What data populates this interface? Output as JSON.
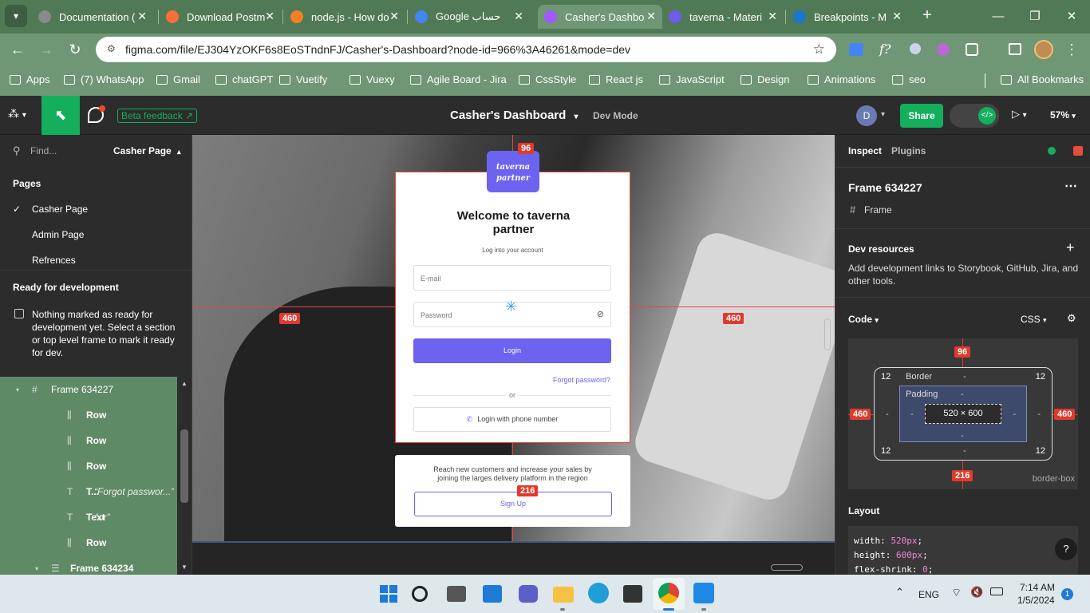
{
  "browser": {
    "tabs": [
      {
        "title": "Documentation (",
        "color": "#8a8a8a"
      },
      {
        "title": "Download Postm",
        "color": "#ff6c37"
      },
      {
        "title": "node.js - How do",
        "color": "#f48024"
      },
      {
        "title": "Google حساب",
        "color": "#4285f4"
      },
      {
        "title": "Casher's Dashbo",
        "color": "#a259ff"
      },
      {
        "title": "taverna - Materi",
        "color": "#6c5ce7"
      },
      {
        "title": "Breakpoints - M",
        "color": "#1976d2"
      }
    ],
    "url": "figma.com/file/EJ304YzOKF6s8EoSTndnFJ/Casher's-Dashboard?node-id=966%3A46261&mode=dev",
    "bookmarks": [
      "Apps",
      "(7) WhatsApp",
      "Gmail",
      "chatGPT",
      "Vuetify",
      "Vuexy",
      "Agile Board - Jira",
      "CssStyle",
      "React js",
      "JavaScript",
      "Design",
      "Animations",
      "seo"
    ],
    "all_bookmarks": "All Bookmarks"
  },
  "figma": {
    "beta_feedback": "Beta feedback",
    "file_title": "Casher's Dashboard",
    "mode": "Dev Mode",
    "avatar": "D",
    "share": "Share",
    "zoom": "57%"
  },
  "left_panel": {
    "find_placeholder": "Find...",
    "current_page": "Casher Page",
    "pages_heading": "Pages",
    "pages": [
      "Casher Page",
      "Admin Page",
      "Refrences"
    ],
    "ready_heading": "Ready for development",
    "ready_text": "Nothing marked as ready for development yet. Select a section or top level frame to mark it ready for dev.",
    "layers": [
      {
        "name": "Frame 634227",
        "type": "frame"
      },
      {
        "name": "Row",
        "type": "row"
      },
      {
        "name": "Row",
        "type": "row"
      },
      {
        "name": "Row",
        "type": "row"
      },
      {
        "name": "T...",
        "type": "text",
        "sub": "“Forgot passwor...”"
      },
      {
        "name": "Text",
        "type": "text",
        "sub": "“or”"
      },
      {
        "name": "Row",
        "type": "row"
      },
      {
        "name": "Frame 634234",
        "type": "frame"
      }
    ]
  },
  "canvas": {
    "logo_line1": "taverna",
    "logo_line2": "partner",
    "welcome_title": "Welcome to taverna partner",
    "subtitle": "Log into your account",
    "email_placeholder": "E-mail",
    "password_placeholder": "Password",
    "login_button": "Login",
    "forgot_password": "Forgot password?",
    "or": "or",
    "phone_login": "Login with phone number",
    "signup_text": "Reach new customers and increase your sales by joining the larges delivery platform in the region",
    "signup_button": "Sign Up",
    "measure_top": "96",
    "measure_left": "460",
    "measure_right": "460",
    "measure_bottom": "216"
  },
  "right_panel": {
    "tabs": [
      "Inspect",
      "Plugins"
    ],
    "frame_name": "Frame 634227",
    "frame_type": "Frame",
    "dev_resources_heading": "Dev resources",
    "dev_resources_text": "Add development links to Storybook, GitHub, Jira, and other tools.",
    "code_heading": "Code",
    "code_lang": "CSS",
    "box_top": "96",
    "box_left": "460",
    "box_right": "460",
    "box_bottom": "216",
    "border_label": "Border",
    "padding_label": "Padding",
    "radius": "12",
    "dash": "-",
    "size": "520 × 600",
    "box_sizing": "border-box",
    "layout_heading": "Layout",
    "css_lines": [
      {
        "prop": "width",
        "val": "520px"
      },
      {
        "prop": "height",
        "val": "600px"
      },
      {
        "prop": "flex-shrink",
        "val": "0"
      }
    ]
  },
  "taskbar": {
    "lang": "ENG",
    "time": "7:14 AM",
    "date": "1/5/2024",
    "notif": "1"
  },
  "colors": {
    "accent": "#6c63f0",
    "figma_green": "#14ae5c",
    "chrome_green": "#6f9675",
    "measure_red": "#e03a2c"
  }
}
